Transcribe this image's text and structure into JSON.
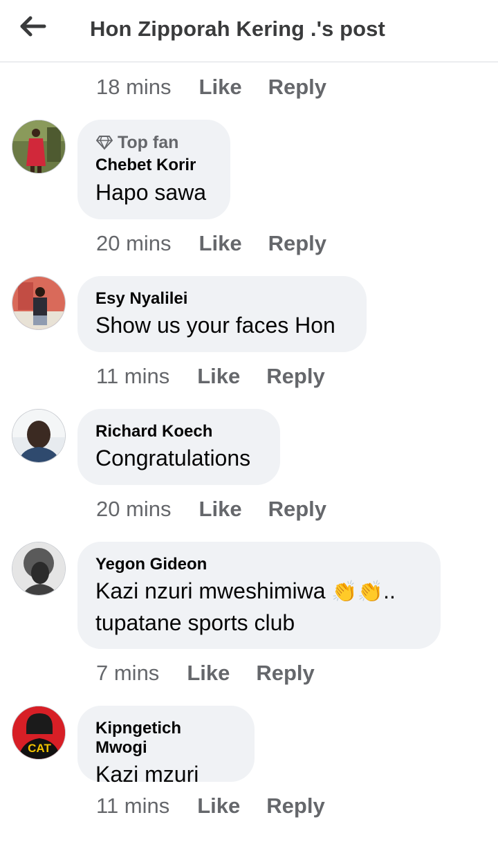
{
  "header": {
    "title": "Hon Zipporah Kering .'s post"
  },
  "top_meta": {
    "time": "18 mins",
    "like": "Like",
    "reply": "Reply"
  },
  "comments": [
    {
      "badge": "Top fan",
      "author": "Chebet Korir",
      "text": "Hapo sawa",
      "time": "20 mins",
      "like": "Like",
      "reply": "Reply"
    },
    {
      "author": "Esy Nyalilei",
      "text": "Show us your faces Hon",
      "time": "11 mins",
      "like": "Like",
      "reply": "Reply"
    },
    {
      "author": "Richard Koech",
      "text": "Congratulations",
      "time": "20 mins",
      "like": "Like",
      "reply": "Reply"
    },
    {
      "author": "Yegon Gideon",
      "text_line1": "Kazi nzuri mweshimiwa",
      "emoji": "👏👏",
      "ellipsis": "..",
      "text_line2": "tupatane sports club",
      "time": "7 mins",
      "like": "Like",
      "reply": "Reply"
    },
    {
      "author": "Kipngetich Mwogi",
      "avatar_text": "CAT",
      "text": "Kazi mzuri",
      "time": "11 mins",
      "like": "Like",
      "reply": "Reply"
    }
  ],
  "colors": {
    "meta_text": "#65676b",
    "bubble": "#f0f2f5",
    "title": "#3a3b3c"
  },
  "icons": {
    "back": "arrow-left-icon",
    "badge": "diamond-icon",
    "clap": "clapping-hands-emoji"
  }
}
